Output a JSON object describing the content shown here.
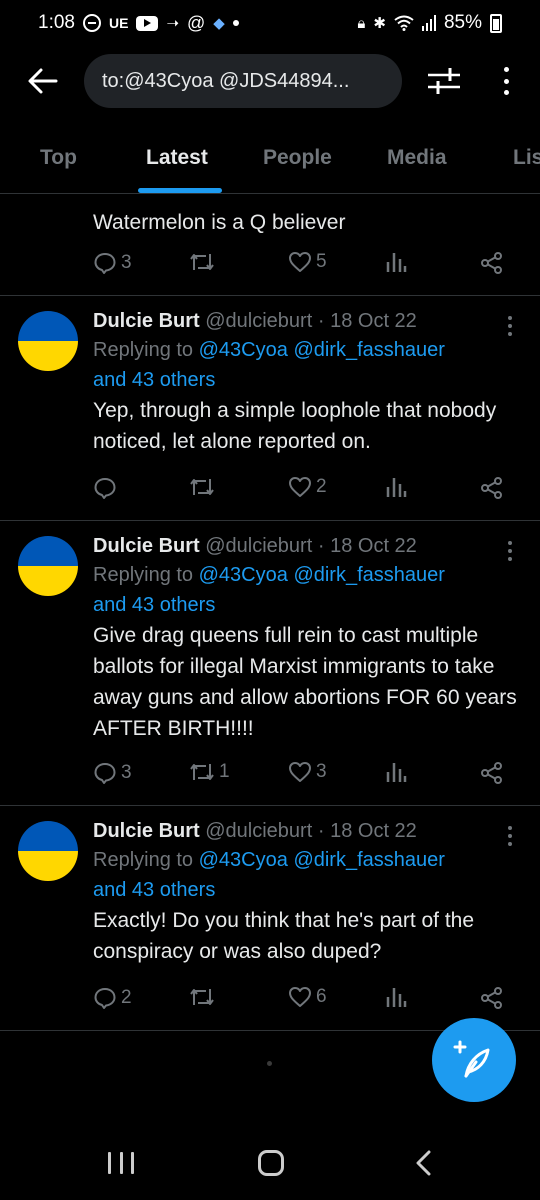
{
  "status_bar": {
    "time": "1:08",
    "carrier": "UE",
    "battery": "85%"
  },
  "search": {
    "query": "to:@43Cyoa @JDS44894..."
  },
  "tabs": [
    {
      "label": "Top"
    },
    {
      "label": "Latest"
    },
    {
      "label": "People"
    },
    {
      "label": "Media"
    },
    {
      "label": "Lis"
    }
  ],
  "posts": [
    {
      "text": "Watermelon is a Q believer",
      "replies": "3",
      "reposts": "",
      "likes": "5"
    },
    {
      "name": "Dulcie Burt",
      "handle": "@dulcieburt",
      "sep": "·",
      "date": "18 Oct 22",
      "reply_prefix": "Replying to",
      "mention1": "@43Cyoa",
      "mention2": "@dirk_fasshauer",
      "reply_suffix": "and 43 others",
      "text": "Yep, through a simple loophole that nobody noticed, let alone reported on.",
      "replies": "",
      "reposts": "",
      "likes": "2"
    },
    {
      "name": "Dulcie Burt",
      "handle": "@dulcieburt",
      "sep": "·",
      "date": "18 Oct 22",
      "reply_prefix": "Replying to",
      "mention1": "@43Cyoa",
      "mention2": "@dirk_fasshauer",
      "reply_suffix": "and 43 others",
      "text": "Give drag queens full rein to cast multiple ballots for illegal Marxist immigrants to take away guns and allow abortions FOR 60 years AFTER BIRTH!!!!",
      "replies": "3",
      "reposts": "1",
      "likes": "3"
    },
    {
      "name": "Dulcie Burt",
      "handle": "@dulcieburt",
      "sep": "·",
      "date": "18 Oct 22",
      "reply_prefix": "Replying to",
      "mention1": "@43Cyoa",
      "mention2": "@dirk_fasshauer",
      "reply_suffix": "and 43 others",
      "text": "Exactly! Do you think that he's part of the conspiracy or was also duped?",
      "replies": "2",
      "reposts": "",
      "likes": "6"
    }
  ],
  "icons": {
    "avatar_flag": "ukraine-flag-avatar",
    "fab": "compose-icon",
    "accent": "#1d9bf0",
    "flag_blue": "#0057b7",
    "flag_yellow": "#ffd700"
  }
}
